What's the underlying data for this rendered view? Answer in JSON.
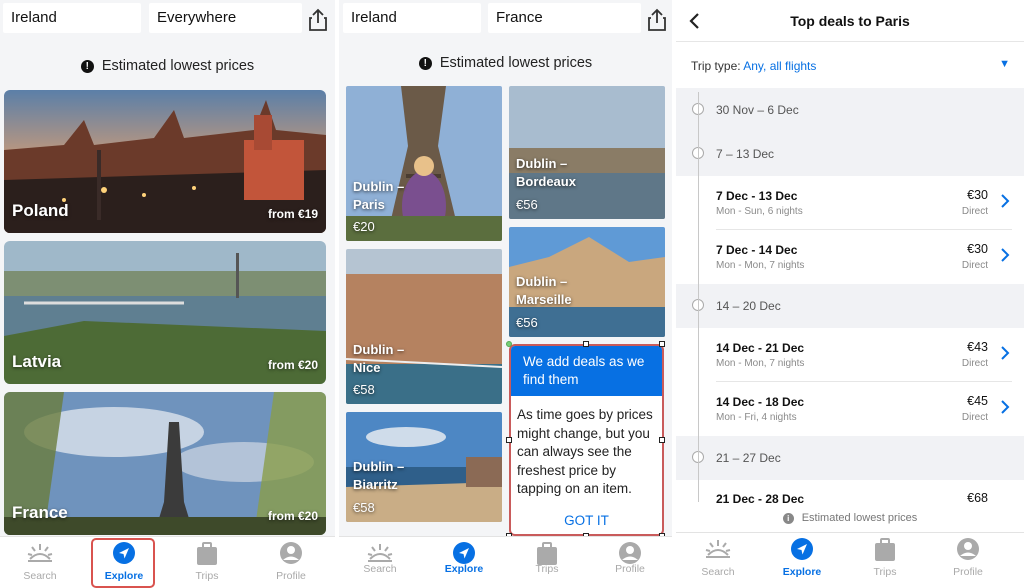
{
  "panel1": {
    "origin": "Ireland",
    "destination": "Everywhere",
    "notice": "Estimated lowest prices",
    "cards": [
      {
        "name": "Poland",
        "price": "from €19"
      },
      {
        "name": "Latvia",
        "price": "from €20"
      },
      {
        "name": "France",
        "price": "from €20"
      }
    ]
  },
  "panel2": {
    "origin": "Ireland",
    "destination": "France",
    "notice": "Estimated lowest prices",
    "tiles": [
      {
        "from": "Dublin –",
        "to": "Paris",
        "price": "€20"
      },
      {
        "from": "Dublin –",
        "to": "Bordeaux",
        "price": "€56"
      },
      {
        "from": "Dublin –",
        "to": "Nice",
        "price": "€58"
      },
      {
        "from": "Dublin –",
        "to": "Marseille",
        "price": "€56"
      },
      {
        "from": "Dublin –",
        "to": "Biarritz",
        "price": "€58"
      }
    ],
    "popover": {
      "title": "We add deals as we find them",
      "body": "As time goes by prices might change, but you can always see the freshest price by tapping on an item.",
      "button": "GOT IT"
    }
  },
  "tabs": [
    {
      "label": "Search",
      "icon": "sunrise-icon"
    },
    {
      "label": "Explore",
      "icon": "compass-arrow-icon"
    },
    {
      "label": "Trips",
      "icon": "suitcase-icon"
    },
    {
      "label": "Profile",
      "icon": "person-icon"
    }
  ],
  "panel3": {
    "title": "Top deals to Paris",
    "trip_type_label": "Trip type:",
    "trip_type_value": "Any, all flights",
    "weeks": [
      {
        "label": "30 Nov – 6 Dec"
      },
      {
        "label": "7 – 13 Dec"
      },
      {
        "label": "14 – 20 Dec"
      },
      {
        "label": "21 – 27 Dec"
      }
    ],
    "deals": [
      {
        "dates": "7 Dec - 13 Dec",
        "sub": "Mon - Sun, 6 nights",
        "price": "€30",
        "type": "Direct"
      },
      {
        "dates": "7 Dec - 14 Dec",
        "sub": "Mon - Mon, 7 nights",
        "price": "€30",
        "type": "Direct"
      },
      {
        "dates": "14 Dec - 21 Dec",
        "sub": "Mon - Mon, 7 nights",
        "price": "€43",
        "type": "Direct"
      },
      {
        "dates": "14 Dec - 18 Dec",
        "sub": "Mon - Fri, 4 nights",
        "price": "€45",
        "type": "Direct"
      },
      {
        "dates": "21 Dec - 28 Dec",
        "sub": "",
        "price": "€68",
        "type": ""
      }
    ],
    "footer": "Estimated lowest prices"
  },
  "colors": {
    "accent": "#0770e3",
    "highlight": "#d9534f"
  }
}
